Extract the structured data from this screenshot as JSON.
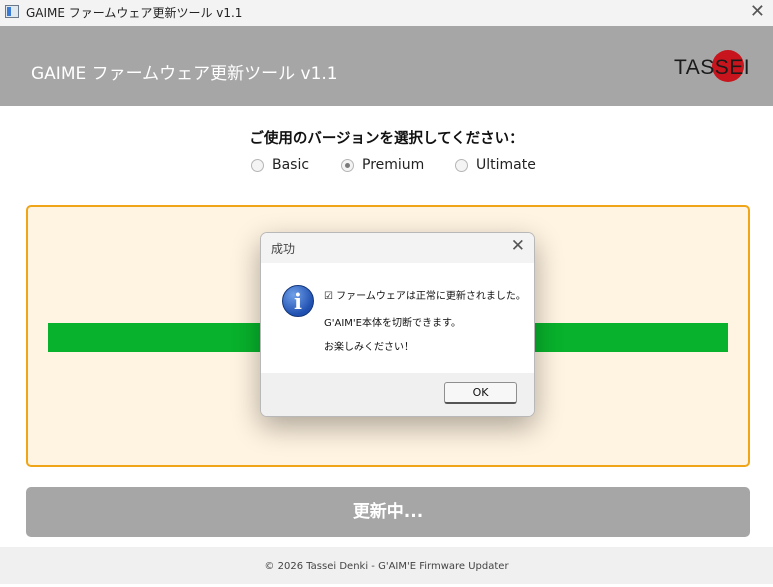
{
  "window": {
    "title": "GAIME ファームウェア更新ツール v1.1",
    "close_glyph": "✕"
  },
  "header": {
    "title": "GAIME ファームウェア更新ツール v1.1",
    "logo": {
      "text": "TASSEI",
      "color": "#c8141c"
    }
  },
  "selection": {
    "prompt": "ご使用のバージョンを選択してください：",
    "options": [
      {
        "label": "Basic",
        "selected": false
      },
      {
        "label": "Premium",
        "selected": true
      },
      {
        "label": "Ultimate",
        "selected": false
      }
    ]
  },
  "progress": {
    "percent": 100,
    "color": "#08b22c",
    "panel_border": "#f0a518",
    "panel_bg": "#fff3e1"
  },
  "update_button": {
    "label": "更新中..."
  },
  "footer": {
    "text": "© 2026 Tassei Denki - G'AIM'E Firmware Updater"
  },
  "dialog": {
    "title": "成功",
    "close_glyph": "✕",
    "icon": "info-icon",
    "icon_glyph": "i",
    "messages": [
      "☑ ファームウェアは正常に更新されました。",
      "G'AIM'E本体を切断できます。",
      "お楽しみください！"
    ],
    "ok_label": "OK"
  }
}
